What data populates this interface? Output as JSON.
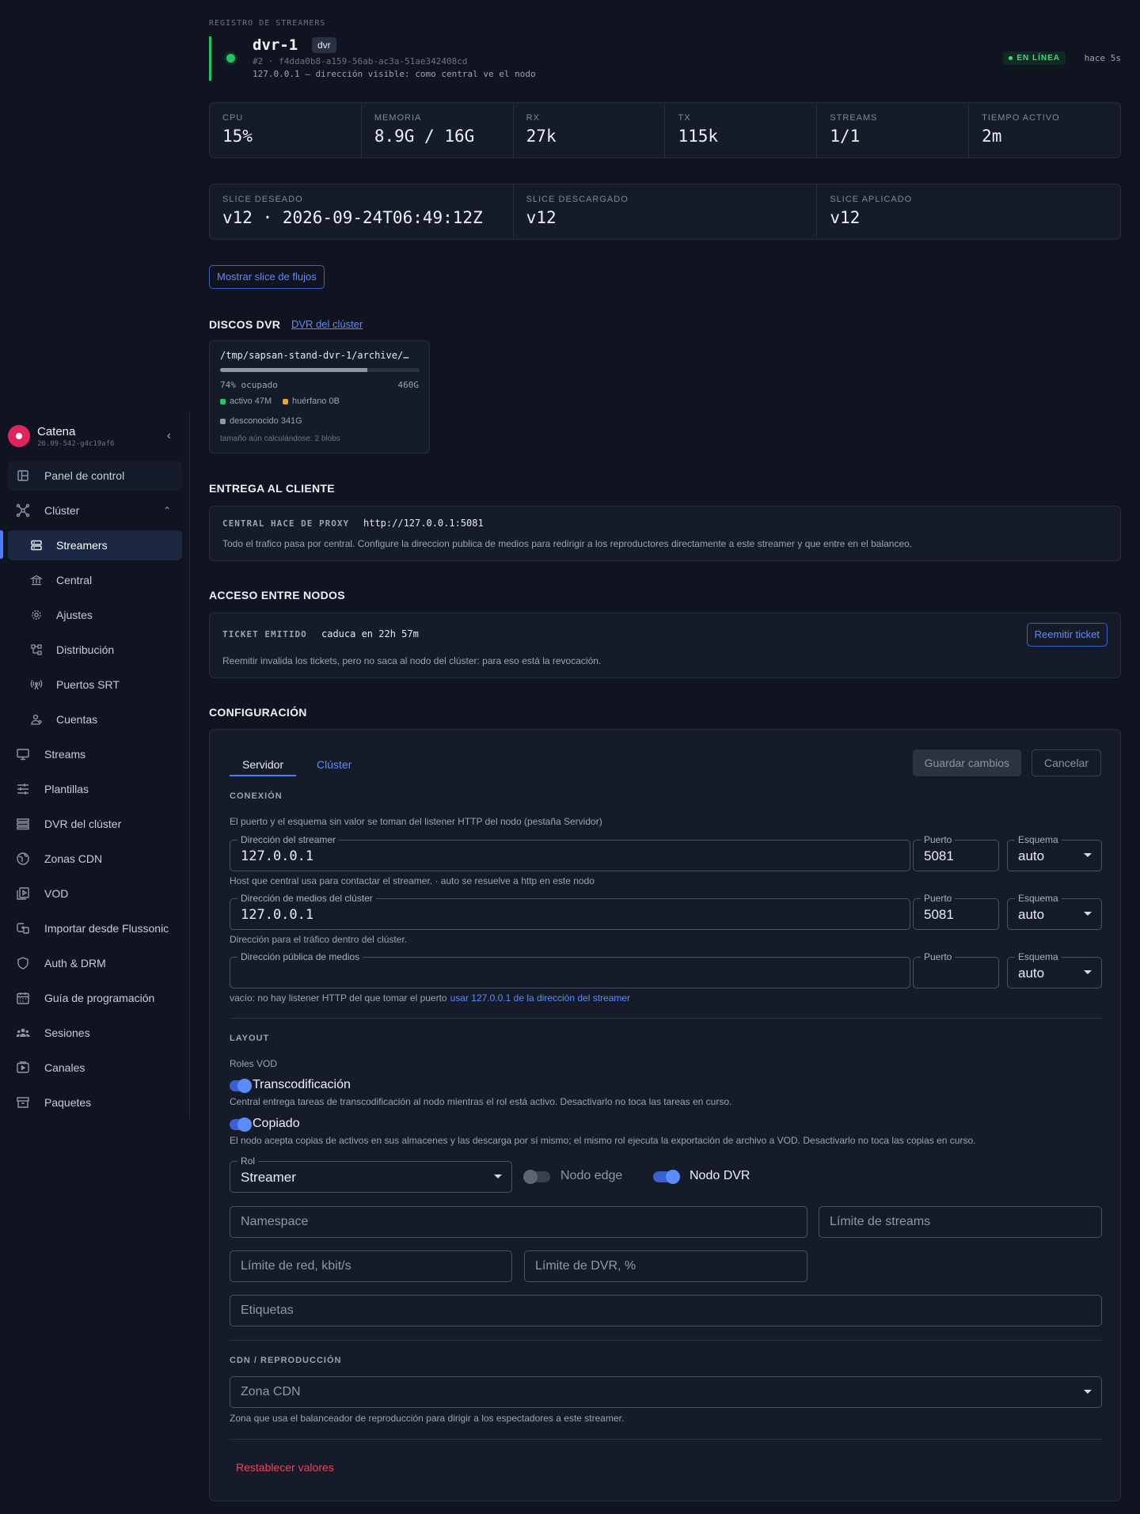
{
  "sidebar": {
    "brand": {
      "name": "Catena",
      "version": "26.09-542-g4c19af6"
    },
    "items": [
      {
        "label": "Panel de control",
        "icon": "dashboard-icon"
      },
      {
        "label": "Clúster",
        "icon": "cluster-icon"
      },
      {
        "label": "Streamers",
        "icon": "server-icon"
      },
      {
        "label": "Central",
        "icon": "bank-icon"
      },
      {
        "label": "Ajustes",
        "icon": "gear-icon"
      },
      {
        "label": "Distribución",
        "icon": "distribution-icon"
      },
      {
        "label": "Puertos SRT",
        "icon": "antenna-icon"
      },
      {
        "label": "Cuentas",
        "icon": "user-icon"
      },
      {
        "label": "Streams",
        "icon": "monitor-icon"
      },
      {
        "label": "Plantillas",
        "icon": "sliders-icon"
      },
      {
        "label": "DVR del clúster",
        "icon": "list-icon"
      },
      {
        "label": "Zonas CDN",
        "icon": "globe-icon"
      },
      {
        "label": "VOD",
        "icon": "library-icon"
      },
      {
        "label": "Importar desde Flussonic",
        "icon": "import-icon"
      },
      {
        "label": "Auth & DRM",
        "icon": "shield-icon"
      },
      {
        "label": "Guía de programación",
        "icon": "calendar-icon"
      },
      {
        "label": "Sesiones",
        "icon": "users-icon"
      },
      {
        "label": "Canales",
        "icon": "play-icon"
      },
      {
        "label": "Paquetes",
        "icon": "archive-icon"
      }
    ]
  },
  "header": {
    "breadcrumb": "REGISTRO DE STREAMERS",
    "name": "dvr-1",
    "tag": "dvr",
    "id_line": "#2 · f4dda0b8-a159-56ab-ac3a-51ae342408cd",
    "addr_line": "127.0.0.1 — dirección visible: como central ve el nodo",
    "status": "EN LÍNEA",
    "last_seen": "hace 5s",
    "status_color": "#3ddc84"
  },
  "stats": [
    {
      "label": "CPU",
      "value": "15%"
    },
    {
      "label": "MEMORIA",
      "value": "8.9G / 16G"
    },
    {
      "label": "RX",
      "value": "27k"
    },
    {
      "label": "TX",
      "value": "115k"
    },
    {
      "label": "STREAMS",
      "value": "1/1"
    },
    {
      "label": "TIEMPO ACTIVO",
      "value": "2m"
    }
  ],
  "slices": [
    {
      "label": "SLICE DESEADO",
      "value": "v12 · 2026-09-24T06:49:12Z"
    },
    {
      "label": "SLICE DESCARGADO",
      "value": "v12"
    },
    {
      "label": "SLICE APLICADO",
      "value": "v12"
    }
  ],
  "show_slice_button": "Mostrar slice de flujos",
  "dvr": {
    "title": "DISCOS DVR",
    "link": "DVR del clúster",
    "disk": {
      "path": "/tmp/sapsan-stand-dvr-1/archive/…",
      "used_fraction": 0.74,
      "used_label": "74% ocupado",
      "capacity": "460G",
      "active": "activo 47M",
      "orphan": "huérfano 0B",
      "unknown": "desconocido 341G",
      "note": "tamaño aún calculándose: 2 blobs",
      "colors": {
        "active": "#22c55e",
        "orphan": "#f5a524",
        "unknown": "#8e96a7"
      }
    }
  },
  "delivery": {
    "title": "ENTREGA AL CLIENTE",
    "key": "CENTRAL HACE DE PROXY",
    "value": "http://127.0.0.1:5081",
    "desc": "Todo el trafico pasa por central. Configure la direccion publica de medios para redirigir a los reproductores directamente a este streamer y que entre en el balanceo."
  },
  "access": {
    "title": "ACCESO ENTRE NODOS",
    "key": "TICKET EMITIDO",
    "value": "caduca en 22h 57m",
    "button": "Reemitir ticket",
    "desc": "Reemitir invalida los tickets, pero no saca al nodo del clúster: para eso está la revocación."
  },
  "config": {
    "title": "CONFIGURACIÓN",
    "tabs": [
      "Servidor",
      "Clúster"
    ],
    "save": "Guardar cambios",
    "cancel": "Cancelar",
    "connection": {
      "title": "CONEXIÓN",
      "help": "El puerto y el esquema sin valor se toman del listener HTTP del nodo (pestaña Servidor)",
      "streamer_addr": {
        "label": "Dirección del streamer",
        "value": "127.0.0.1",
        "port_label": "Puerto",
        "port": "5081",
        "scheme_label": "Esquema",
        "scheme": "auto",
        "help": "Host que central usa para contactar el streamer. · auto se resuelve a http en este nodo"
      },
      "cluster_addr": {
        "label": "Dirección de medios del clúster",
        "value": "127.0.0.1",
        "port_label": "Puerto",
        "port": "5081",
        "scheme_label": "Esquema",
        "scheme": "auto",
        "help": "Dirección para el tráfico dentro del clúster."
      },
      "public_addr": {
        "label": "Dirección pública de medios",
        "value": "",
        "port_label": "Puerto",
        "port": "",
        "scheme_label": "Esquema",
        "scheme": "auto",
        "help": "vacío: no hay listener HTTP del que tomar el puerto",
        "help_link": "usar 127.0.0.1 de la dirección del streamer"
      }
    },
    "layout": {
      "title": "LAYOUT",
      "roles_label": "Roles VOD",
      "transcoding": {
        "label": "Transcodificación",
        "on": true,
        "help": "Central entrega tareas de transcodificación al nodo mientras el rol está activo. Desactivarlo no toca las tareas en curso."
      },
      "copying": {
        "label": "Copiado",
        "on": true,
        "help": "El nodo acepta copias de activos en sus almacenes y las descarga por sí mismo; el mismo rol ejecuta la exportación de archivo a VOD. Desactivarlo no toca las copias en curso."
      },
      "role_label": "Rol",
      "role": "Streamer",
      "edge_node": {
        "label": "Nodo edge",
        "on": false
      },
      "dvr_node": {
        "label": "Nodo DVR",
        "on": true
      },
      "namespace_ph": "Namespace",
      "stream_limit_ph": "Límite de streams",
      "net_limit_ph": "Límite de red, kbit/s",
      "dvr_limit_ph": "Límite de DVR, %",
      "tags_ph": "Etiquetas"
    },
    "cdn": {
      "title": "CDN / REPRODUCCIÓN",
      "zone_ph": "Zona CDN",
      "help": "Zona que usa el balanceador de reproducción para dirigir a los espectadores a este streamer."
    },
    "reset": "Restablecer valores"
  }
}
